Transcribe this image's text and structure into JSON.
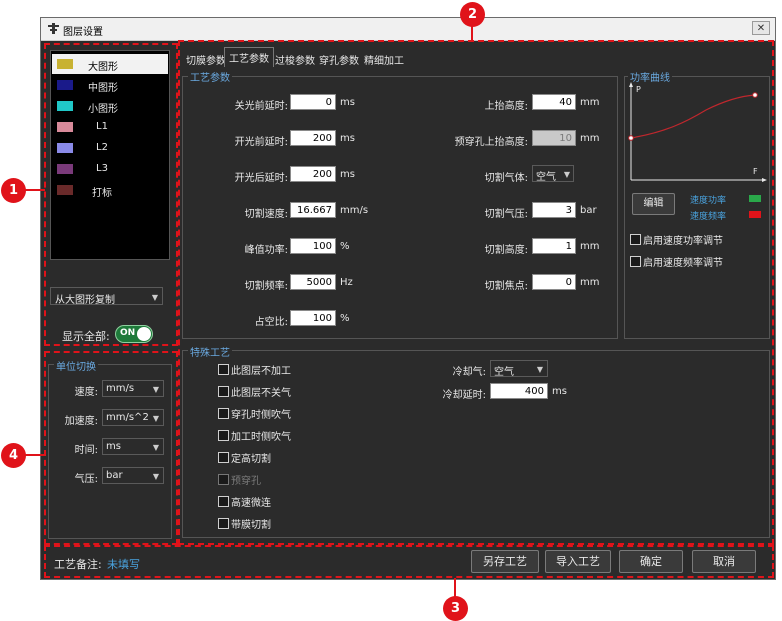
{
  "window": {
    "title": "图层设置",
    "close_symbol": "✕"
  },
  "callouts": [
    "1",
    "2",
    "3",
    "4"
  ],
  "layers": [
    {
      "label": "大图形",
      "color": "#c8b232",
      "selected": true
    },
    {
      "label": "中图形",
      "color": "#1a1a8a",
      "selected": false
    },
    {
      "label": "小图形",
      "color": "#20c8c8",
      "selected": false
    },
    {
      "label": "L1",
      "color": "#d88a9a",
      "selected": false
    },
    {
      "label": "L2",
      "color": "#8a8ae8",
      "selected": false
    },
    {
      "label": "L3",
      "color": "#7a3a7a",
      "selected": false
    },
    {
      "label": "打标",
      "color": "#6a2a2a",
      "selected": false
    }
  ],
  "copy_from": {
    "value": "从大图形复制"
  },
  "show_all": {
    "label": "显示全部:",
    "toggle_text": "ON"
  },
  "units": {
    "title": "单位切换",
    "rows": [
      {
        "label": "速度:",
        "value": "mm/s"
      },
      {
        "label": "加速度:",
        "value": "mm/s^2"
      },
      {
        "label": "时间:",
        "value": "ms"
      },
      {
        "label": "气压:",
        "value": "bar"
      }
    ]
  },
  "tabs": [
    "切膜参数",
    "工艺参数",
    "过梭参数",
    "穿孔参数",
    "精细加工"
  ],
  "active_tab": "工艺参数",
  "process_params": {
    "title": "工艺参数",
    "left": [
      {
        "label": "关光前延时:",
        "value": "0",
        "unit": "ms"
      },
      {
        "label": "开光前延时:",
        "value": "200",
        "unit": "ms"
      },
      {
        "label": "开光后延时:",
        "value": "200",
        "unit": "ms"
      },
      {
        "label": "切割速度:",
        "value": "16.667",
        "unit": "mm/s"
      },
      {
        "label": "峰值功率:",
        "value": "100",
        "unit": "%"
      },
      {
        "label": "切割频率:",
        "value": "5000",
        "unit": "Hz"
      },
      {
        "label": "占空比:",
        "value": "100",
        "unit": "%"
      }
    ],
    "right": [
      {
        "label": "上抬高度:",
        "value": "40",
        "unit": "mm",
        "kind": "input"
      },
      {
        "label": "预穿孔上抬高度:",
        "value": "10",
        "unit": "mm",
        "kind": "disabled"
      },
      {
        "label": "切割气体:",
        "value": "空气",
        "unit": "",
        "kind": "select"
      },
      {
        "label": "切割气压:",
        "value": "3",
        "unit": "bar",
        "kind": "input"
      },
      {
        "label": "切割高度:",
        "value": "1",
        "unit": "mm",
        "kind": "input"
      },
      {
        "label": "切割焦点:",
        "value": "0",
        "unit": "mm",
        "kind": "input"
      }
    ]
  },
  "power_curve": {
    "title": "功率曲线",
    "axis_p": "P",
    "axis_f": "F",
    "edit_label": "编辑",
    "legend": [
      {
        "label": "速度功率",
        "color": "#2aa84a"
      },
      {
        "label": "速度频率",
        "color": "#e0131a"
      }
    ],
    "options": [
      "启用速度功率调节",
      "启用速度频率调节"
    ],
    "curve_color": "#c0272d"
  },
  "special": {
    "title": "特殊工艺",
    "checks": [
      {
        "label": "此图层不加工",
        "disabled": false
      },
      {
        "label": "此图层不关气",
        "disabled": false
      },
      {
        "label": "穿孔时侧吹气",
        "disabled": false
      },
      {
        "label": "加工时侧吹气",
        "disabled": false
      },
      {
        "label": "定高切割",
        "disabled": false
      },
      {
        "label": "预穿孔",
        "disabled": true
      },
      {
        "label": "高速微连",
        "disabled": false
      },
      {
        "label": "带膜切割",
        "disabled": false
      }
    ],
    "cool_gas": {
      "label": "冷却气:",
      "value": "空气"
    },
    "cool_delay": {
      "label": "冷却延时:",
      "value": "400",
      "unit": "ms"
    }
  },
  "footer": {
    "note_label": "工艺备注:",
    "note_value": "未填写",
    "buttons": [
      "另存工艺",
      "导入工艺",
      "确定",
      "取消"
    ]
  }
}
